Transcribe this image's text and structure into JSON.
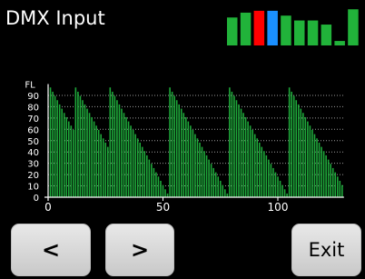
{
  "header": {
    "title": "DMX Input"
  },
  "status_bars": [
    {
      "level": 0.75,
      "color": "#21b33a"
    },
    {
      "level": 0.88,
      "color": "#21b33a"
    },
    {
      "level": 0.93,
      "color": "#ff0000"
    },
    {
      "level": 0.93,
      "color": "#1a8fff"
    },
    {
      "level": 0.8,
      "color": "#21b33a"
    },
    {
      "level": 0.67,
      "color": "#21b33a"
    },
    {
      "level": 0.67,
      "color": "#21b33a"
    },
    {
      "level": 0.56,
      "color": "#21b33a"
    },
    {
      "level": 0.12,
      "color": "#21b33a"
    },
    {
      "level": 0.97,
      "color": "#21b33a"
    }
  ],
  "chart_data": {
    "type": "bar",
    "ylabel": "FL",
    "ylim": [
      0,
      100
    ],
    "xlim": [
      0,
      128
    ],
    "ytick_labels": [
      "0",
      "10",
      "20",
      "30",
      "40",
      "50",
      "60",
      "70",
      "80",
      "90"
    ],
    "ytick_values": [
      0,
      10,
      20,
      30,
      40,
      50,
      60,
      70,
      80,
      90
    ],
    "xtick_labels": [
      "0",
      "50",
      "100"
    ],
    "xtick_values": [
      0,
      50,
      100
    ],
    "grid": true,
    "bar_color": "#1ea83a",
    "sawtooth_starts": [
      1,
      12,
      27,
      53,
      79,
      105
    ],
    "sawtooth_peak": 97,
    "sawtooth_step": 3.75
  },
  "buttons": {
    "prev_label": "<",
    "next_label": ">",
    "exit_label": "Exit"
  },
  "colors": {
    "background": "#000000",
    "bar": "#1ea83a",
    "button": "#d9d9d9"
  }
}
